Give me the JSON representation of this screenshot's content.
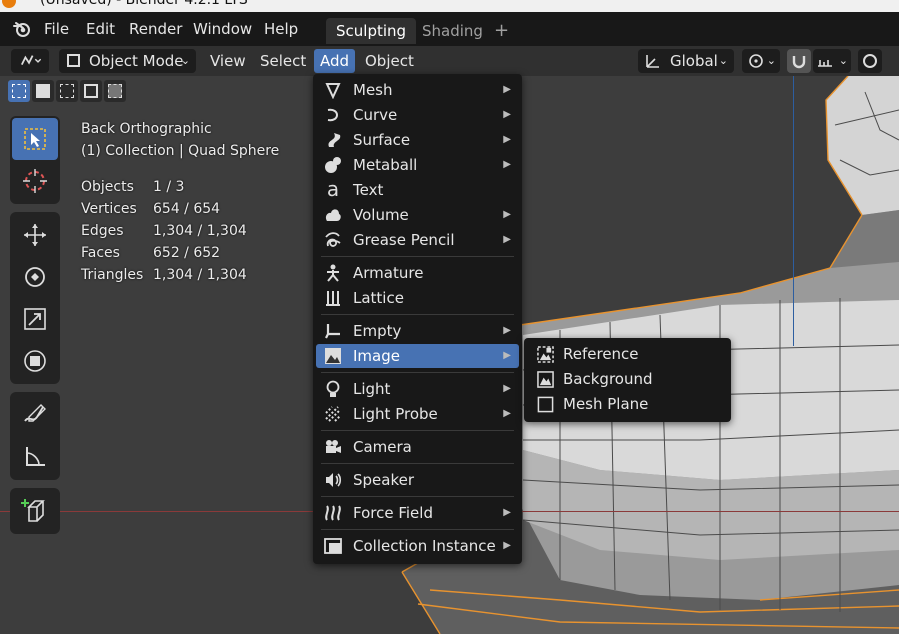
{
  "window": {
    "title": "(Unsaved) - Blender 4.2.1 LTS"
  },
  "topmenu": [
    "File",
    "Edit",
    "Render",
    "Window",
    "Help"
  ],
  "workspaces": {
    "active": "Sculpting",
    "inactive": "Shading",
    "add": "+"
  },
  "header": {
    "mode": "Object Mode",
    "menus": [
      "View",
      "Select",
      "Add",
      "Object"
    ],
    "orientation": "Global"
  },
  "overlay": {
    "view": "Back Orthographic",
    "collection": "(1) Collection | Quad Sphere",
    "stats": [
      {
        "k": "Objects",
        "v": "1 / 3"
      },
      {
        "k": "Vertices",
        "v": "654 / 654"
      },
      {
        "k": "Edges",
        "v": "1,304 / 1,304"
      },
      {
        "k": "Faces",
        "v": "652 / 652"
      },
      {
        "k": "Triangles",
        "v": "1,304 / 1,304"
      }
    ]
  },
  "add_menu": [
    {
      "label": "Mesh",
      "icon": "mesh-icon",
      "sub": true
    },
    {
      "label": "Curve",
      "icon": "curve-icon",
      "sub": true
    },
    {
      "label": "Surface",
      "icon": "surface-icon",
      "sub": true
    },
    {
      "label": "Metaball",
      "icon": "metaball-icon",
      "sub": true
    },
    {
      "label": "Text",
      "icon": "text-icon",
      "sub": false
    },
    {
      "label": "Volume",
      "icon": "volume-icon",
      "sub": true
    },
    {
      "label": "Grease Pencil",
      "icon": "grease-pencil-icon",
      "sub": true
    },
    {
      "label": "Armature",
      "icon": "armature-icon",
      "sub": false
    },
    {
      "label": "Lattice",
      "icon": "lattice-icon",
      "sub": false
    },
    {
      "label": "Empty",
      "icon": "empty-icon",
      "sub": true
    },
    {
      "label": "Image",
      "icon": "image-icon",
      "sub": true,
      "highlight": true
    },
    {
      "label": "Light",
      "icon": "light-icon",
      "sub": true
    },
    {
      "label": "Light Probe",
      "icon": "light-probe-icon",
      "sub": true
    },
    {
      "label": "Camera",
      "icon": "camera-icon",
      "sub": false
    },
    {
      "label": "Speaker",
      "icon": "speaker-icon",
      "sub": false
    },
    {
      "label": "Force Field",
      "icon": "force-field-icon",
      "sub": true
    },
    {
      "label": "Collection Instance",
      "icon": "collection-instance-icon",
      "sub": true
    }
  ],
  "image_submenu": [
    {
      "label": "Reference",
      "icon": "reference-image-icon"
    },
    {
      "label": "Background",
      "icon": "background-image-icon"
    },
    {
      "label": "Mesh Plane",
      "icon": "mesh-plane-icon"
    }
  ],
  "colors": {
    "accent": "#4772b3",
    "wire": "#e8932f",
    "menu_bg": "#181818"
  }
}
